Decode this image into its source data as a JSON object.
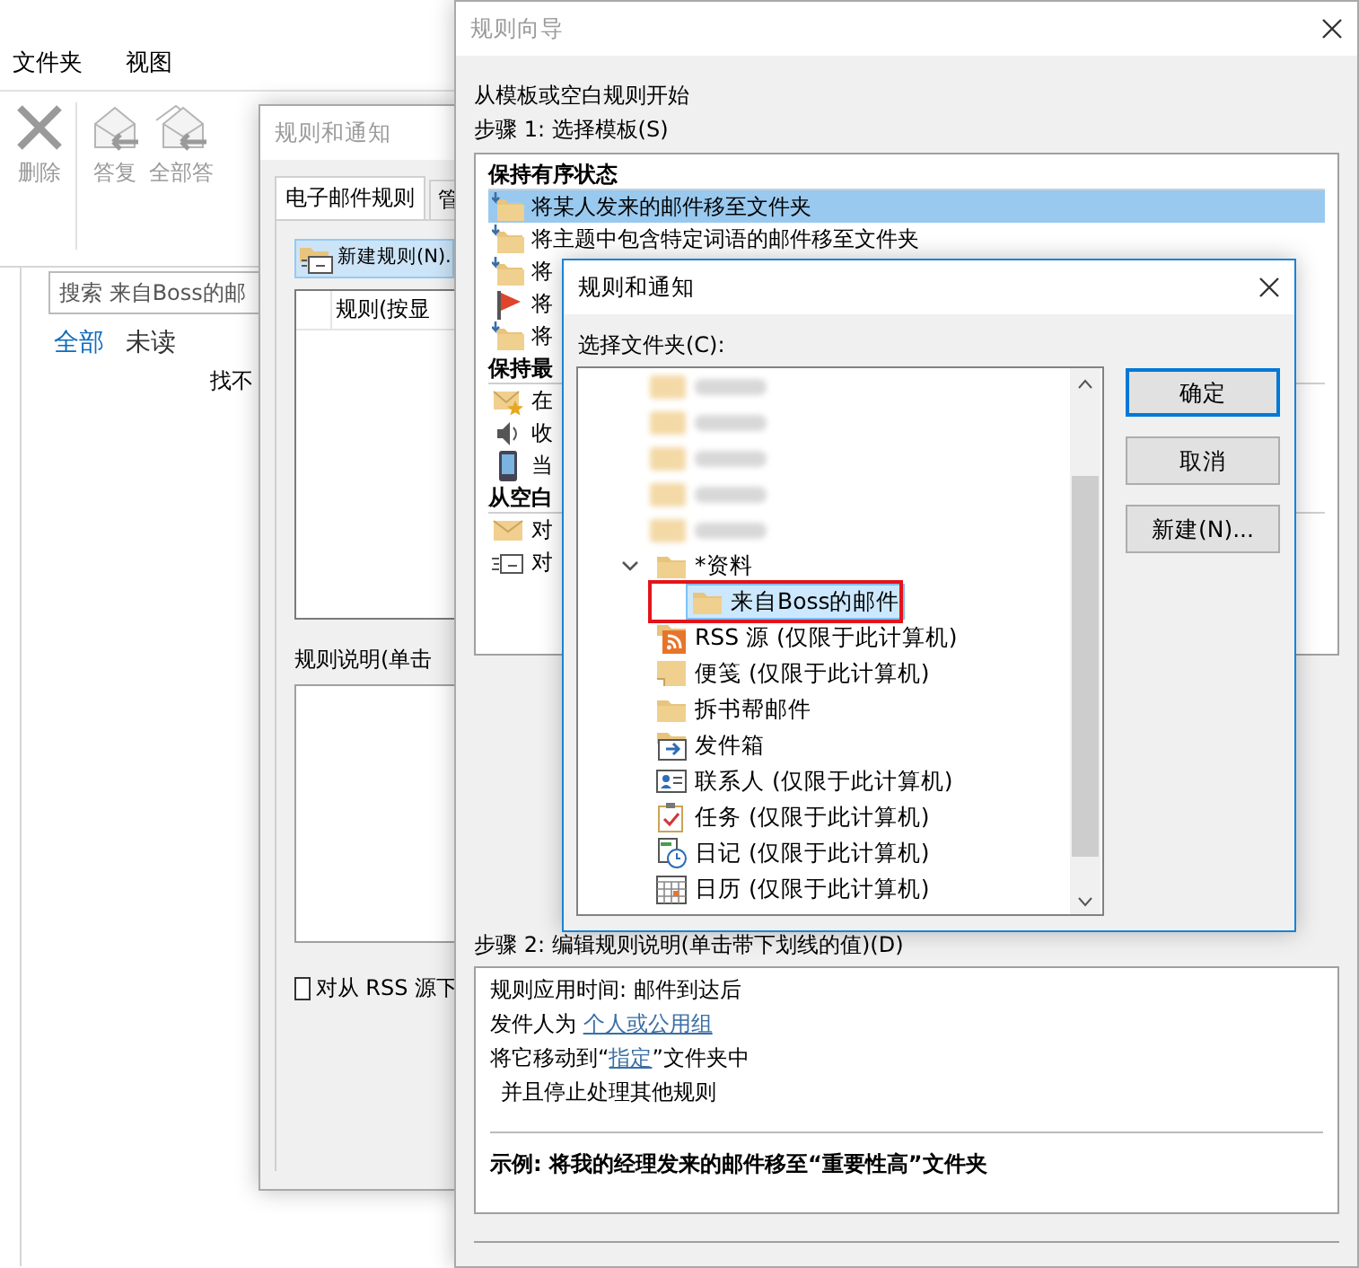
{
  "mail_window": {
    "menu_tabs": [
      "文件夹",
      "视图"
    ],
    "ribbon_buttons": [
      {
        "label": "删除",
        "kind": "delete",
        "disabled": true
      },
      {
        "label": "答复",
        "kind": "reply",
        "disabled": true
      },
      {
        "label": "全部答",
        "kind": "reply_all",
        "disabled": true
      }
    ],
    "search": {
      "placeholder": "搜索 来自Boss的邮"
    },
    "filters": [
      {
        "label": "全部",
        "selected": true
      },
      {
        "label": "未读",
        "selected": false
      }
    ],
    "message": "找不"
  },
  "rules_dialog": {
    "title": "规则和通知",
    "active": false,
    "tabs": [
      {
        "label": "电子邮件规则",
        "selected": true
      },
      {
        "label": "管",
        "selected": false
      }
    ],
    "new_rule_button": "新建规则(N).",
    "rules_column": "规则(按显",
    "description_label": "规则说明(单击",
    "rss_checkbox": {
      "label": "对从 RSS 源下",
      "checked": false
    }
  },
  "wizard": {
    "title": "规则向导",
    "active": false,
    "intro": "从模板或空白规则开始",
    "step1_label": "步骤 1: 选择模板(S)",
    "template_groups": [
      {
        "label": "保持有序状态",
        "items": [
          {
            "label": "将某人发来的邮件移至文件夹",
            "kind": "move",
            "selected": true
          },
          {
            "label": "将主题中包含特定词语的邮件移至文件夹",
            "kind": "move",
            "selected": false
          },
          {
            "label": "将",
            "kind": "move",
            "selected": false
          },
          {
            "label": "将",
            "kind": "flag",
            "selected": false
          },
          {
            "label": "将",
            "kind": "move",
            "selected": false
          }
        ]
      },
      {
        "label": "保持最",
        "items": [
          {
            "label": "在",
            "kind": "mail_star",
            "selected": false
          },
          {
            "label": "收",
            "kind": "speaker",
            "selected": false
          },
          {
            "label": "当",
            "kind": "phone",
            "selected": false
          }
        ]
      },
      {
        "label": "从空白",
        "items": [
          {
            "label": "对",
            "kind": "mail",
            "selected": false
          },
          {
            "label": "对",
            "kind": "new_mail",
            "selected": false
          }
        ]
      }
    ],
    "step2_label": "步骤 2: 编辑规则说明(单击带下划线的值)(D)",
    "description": [
      {
        "kind": "line",
        "parts": [
          {
            "text": "规则应用时间: 邮件到达后"
          }
        ]
      },
      {
        "kind": "line",
        "parts": [
          {
            "text": "发件人为 "
          },
          {
            "text": "个人或公用组",
            "link": true
          }
        ]
      },
      {
        "kind": "line",
        "parts": [
          {
            "text": "将它移动到“"
          },
          {
            "text": "指定",
            "link": true
          },
          {
            "text": "”文件夹中"
          }
        ]
      },
      {
        "kind": "sub",
        "parts": [
          {
            "text": "并且停止处理其他规则"
          }
        ]
      }
    ],
    "example": "示例: 将我的经理发来的邮件移至“重要性高”文件夹"
  },
  "folder_dialog": {
    "title": "规则和通知",
    "active": true,
    "label": "选择文件夹(C):",
    "folders": [
      {
        "kind": "blurred"
      },
      {
        "kind": "blurred"
      },
      {
        "kind": "blurred"
      },
      {
        "kind": "blurred"
      },
      {
        "kind": "blurred"
      },
      {
        "label": "*资料",
        "kind": "folder",
        "selected": false,
        "expanded": true,
        "children": [
          {
            "label": "来自Boss的邮件",
            "kind": "folder",
            "selected": true,
            "highlighted": true
          }
        ]
      },
      {
        "label": "RSS 源 (仅限于此计算机)",
        "kind": "rss",
        "selected": false
      },
      {
        "label": "便笺 (仅限于此计算机)",
        "kind": "note",
        "selected": false
      },
      {
        "label": "拆书帮邮件",
        "kind": "folder",
        "selected": false
      },
      {
        "label": "发件箱",
        "kind": "outbox",
        "selected": false
      },
      {
        "label": "联系人 (仅限于此计算机)",
        "kind": "contacts",
        "selected": false
      },
      {
        "label": "任务 (仅限于此计算机)",
        "kind": "tasks",
        "selected": false
      },
      {
        "label": "日记 (仅限于此计算机)",
        "kind": "journal",
        "selected": false
      },
      {
        "label": "日历 (仅限于此计算机)",
        "kind": "calendar",
        "selected": false
      }
    ],
    "buttons": [
      {
        "label": "确定",
        "default": true
      },
      {
        "label": "取消",
        "default": false
      },
      {
        "label": "新建(N)...",
        "default": false
      }
    ]
  }
}
